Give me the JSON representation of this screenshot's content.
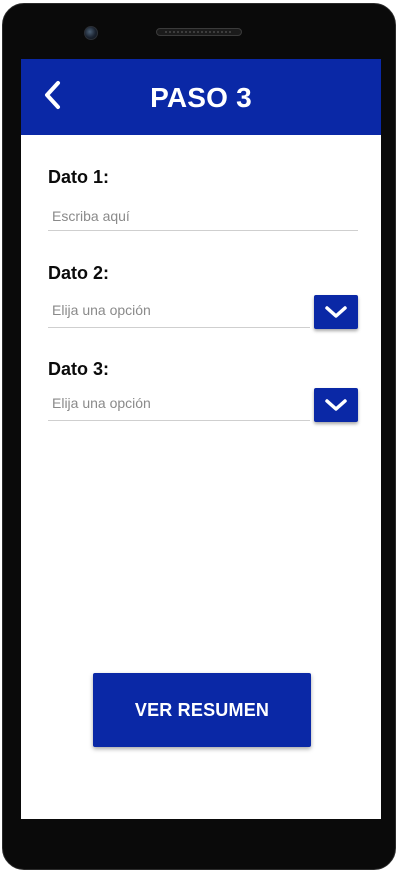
{
  "header": {
    "title": "PASO 3"
  },
  "form": {
    "dato1": {
      "label": "Dato 1:",
      "placeholder": "Escriba aquí"
    },
    "dato2": {
      "label": "Dato 2:",
      "placeholder": "Elija una opción"
    },
    "dato3": {
      "label": "Dato 3:",
      "placeholder": "Elija una opción"
    }
  },
  "actions": {
    "primary_label": "VER RESUMEN"
  },
  "icons": {
    "back": "chevron-left-icon",
    "dropdown": "chevron-down-icon"
  },
  "colors": {
    "primary": "#0A28A6",
    "background": "#FFFFFF",
    "phone_frame": "#0A0A0A"
  }
}
